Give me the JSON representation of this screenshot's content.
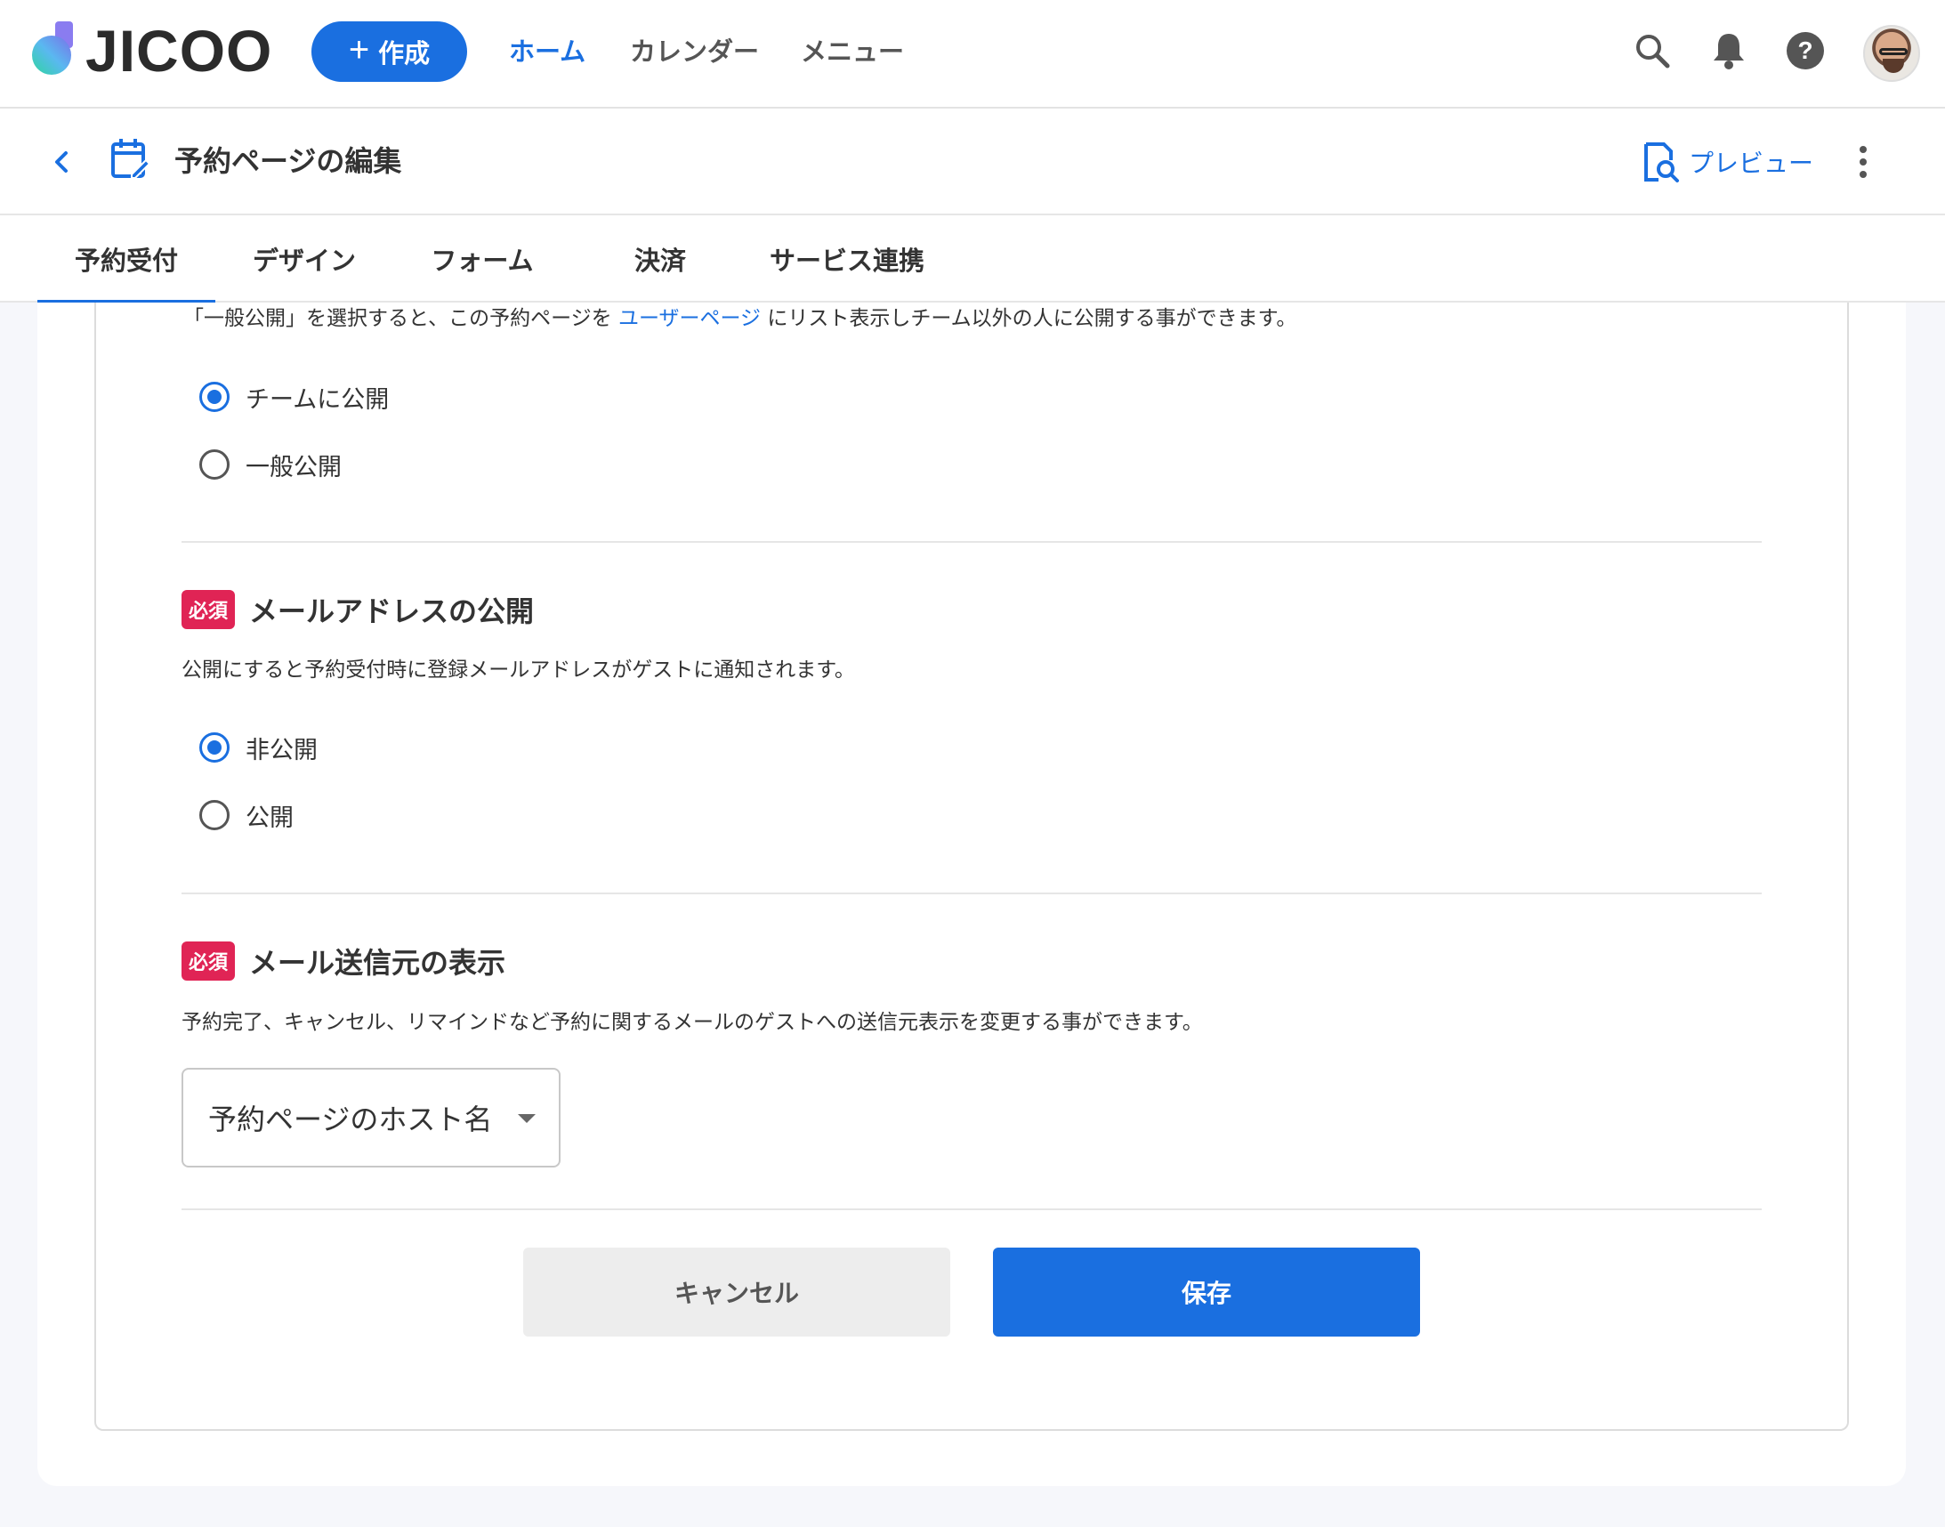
{
  "app": {
    "logo_text": "JICOO"
  },
  "topnav": {
    "create_label": "作成",
    "links": [
      {
        "label": "ホーム"
      },
      {
        "label": "カレンダー"
      },
      {
        "label": "メニュー"
      }
    ],
    "icons": [
      "search-icon",
      "bell-icon",
      "help-icon"
    ]
  },
  "subheader": {
    "title": "予約ページの編集",
    "preview_label": "プレビュー"
  },
  "tabs": [
    {
      "label": "予約受付"
    },
    {
      "label": "デザイン"
    },
    {
      "label": "フォーム"
    },
    {
      "label": "決済"
    },
    {
      "label": "サービス連携"
    }
  ],
  "publish_section": {
    "desc_before": "「一般公開」を選択すると、この予約ページを",
    "desc_link": "ユーザーページ",
    "desc_after": "にリスト表示しチーム以外の人に公開する事ができます。",
    "options": [
      {
        "label": "チームに公開",
        "checked": true
      },
      {
        "label": "一般公開",
        "checked": false
      }
    ]
  },
  "email_section": {
    "badge": "必須",
    "title": "メールアドレスの公開",
    "desc": "公開にすると予約受付時に登録メールアドレスがゲストに通知されます。",
    "options": [
      {
        "label": "非公開",
        "checked": true
      },
      {
        "label": "公開",
        "checked": false
      }
    ]
  },
  "sender_section": {
    "badge": "必須",
    "title": "メール送信元の表示",
    "desc": "予約完了、キャンセル、リマインドなど予約に関するメールのゲストへの送信元表示を変更する事ができます。",
    "select_value": "予約ページのホスト名"
  },
  "actions": {
    "cancel_label": "キャンセル",
    "save_label": "保存"
  },
  "colors": {
    "primary": "#1a6fe0",
    "required": "#e02455"
  }
}
